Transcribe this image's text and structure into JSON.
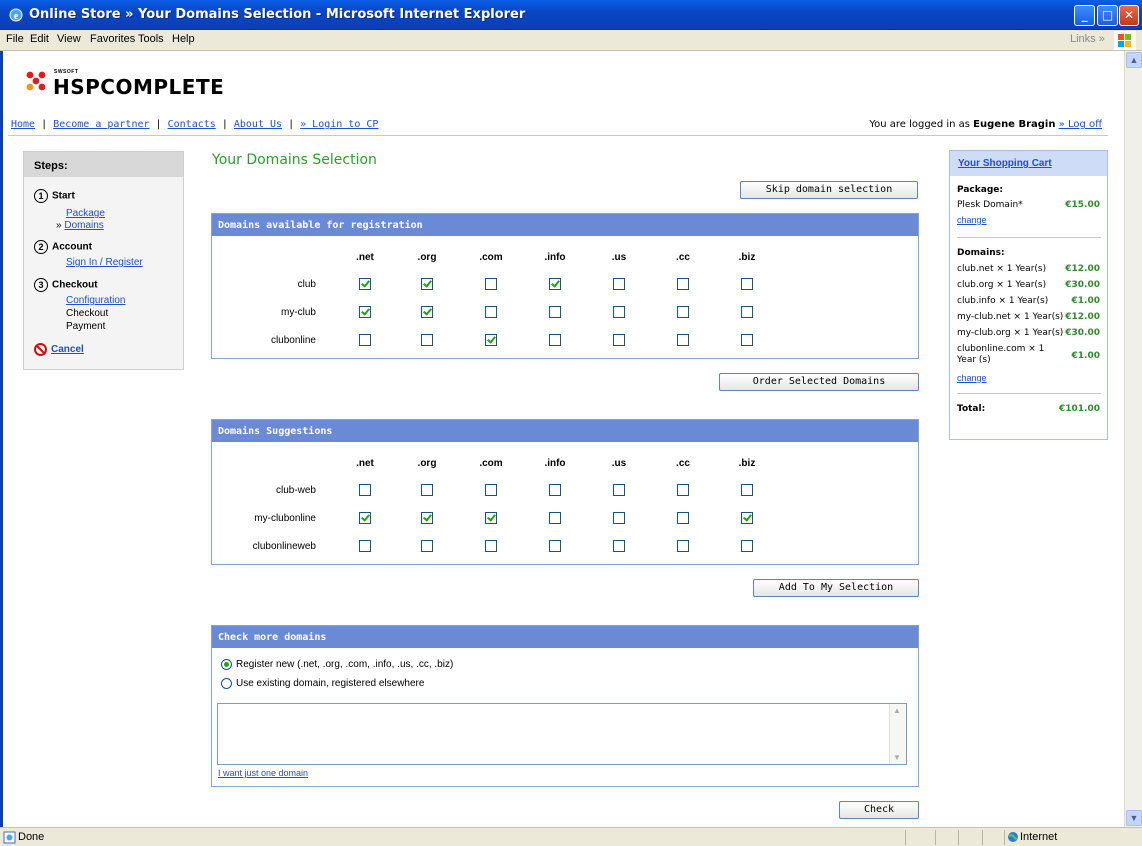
{
  "window": {
    "title": "Online Store » Your Domains Selection - Microsoft Internet Explorer"
  },
  "menu": {
    "items": [
      "File",
      "Edit",
      "View",
      "Favorites",
      "Tools",
      "Help"
    ],
    "links_label": "Links"
  },
  "logo": {
    "brand_small": "SWSOFT",
    "brand": "HSPCOMPLETE"
  },
  "nav": {
    "home": "Home",
    "partner": "Become a partner",
    "contacts": "Contacts",
    "about": "About Us",
    "login_cp": "» Login to CP",
    "sep": "|",
    "logged_prefix": "You are logged in as",
    "user": "Eugene Bragin",
    "logoff": "» Log off"
  },
  "steps": {
    "title": "Steps:",
    "start": {
      "num": "1",
      "label": "Start",
      "package": "Package",
      "domains_prefix": "»",
      "domains": "Domains"
    },
    "account": {
      "num": "2",
      "label": "Account",
      "signin": "Sign In / Register"
    },
    "checkout": {
      "num": "3",
      "label": "Checkout",
      "configuration": "Configuration",
      "checkout": "Checkout",
      "payment": "Payment"
    },
    "cancel": "Cancel"
  },
  "page": {
    "title": "Your Domains Selection"
  },
  "buttons": {
    "skip": "Skip domain selection",
    "order": "Order Selected Domains",
    "add": "Add To My Selection",
    "check": "Check"
  },
  "tlds": [
    ".net",
    ".org",
    ".com",
    ".info",
    ".us",
    ".cc",
    ".biz"
  ],
  "available": {
    "title": "Domains available for registration",
    "rows": [
      {
        "name": "club",
        "checked": [
          true,
          true,
          false,
          true,
          false,
          false,
          false
        ]
      },
      {
        "name": "my-club",
        "checked": [
          true,
          true,
          false,
          false,
          false,
          false,
          false
        ]
      },
      {
        "name": "clubonline",
        "checked": [
          false,
          false,
          true,
          false,
          false,
          false,
          false
        ]
      }
    ]
  },
  "suggestions": {
    "title": "Domains Suggestions",
    "rows": [
      {
        "name": "club-web",
        "checked": [
          false,
          false,
          false,
          false,
          false,
          false,
          false
        ]
      },
      {
        "name": "my-clubonline",
        "checked": [
          true,
          true,
          true,
          false,
          false,
          false,
          true
        ]
      },
      {
        "name": "clubonlineweb",
        "checked": [
          false,
          false,
          false,
          false,
          false,
          false,
          false
        ]
      }
    ]
  },
  "check_more": {
    "title": "Check more domains",
    "opt_register": "Register new (.net, .org, .com, .info, .us, .cc, .biz)",
    "opt_existing": "Use existing domain, registered elsewhere",
    "one_domain": "I want just one domain"
  },
  "cart": {
    "title": "Your Shopping Cart",
    "package_label": "Package:",
    "package_name": "Plesk Domain*",
    "package_price": "€15.00",
    "change": "change",
    "domains_label": "Domains:",
    "items": [
      {
        "name": "club.net × 1 Year(s)",
        "price": "€12.00"
      },
      {
        "name": "club.org × 1 Year(s)",
        "price": "€30.00"
      },
      {
        "name": "club.info × 1 Year(s)",
        "price": "€1.00"
      },
      {
        "name": "my-club.net × 1 Year(s)",
        "price": "€12.00"
      },
      {
        "name": "my-club.org × 1 Year(s)",
        "price": "€30.00"
      },
      {
        "name": "clubonline.com × 1 Year (s)",
        "price": "€1.00"
      }
    ],
    "total_label": "Total:",
    "total": "€101.00"
  },
  "status": {
    "text": "Done",
    "zone": "Internet"
  }
}
